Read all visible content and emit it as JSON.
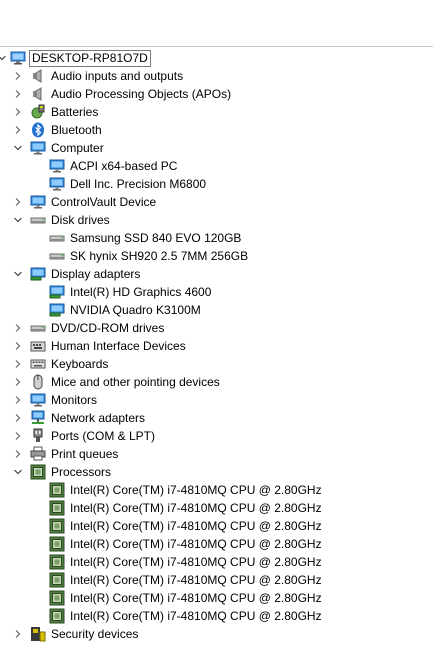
{
  "tree": {
    "root": {
      "label": "DESKTOP-RP81O7D",
      "icon": "computer-icon"
    },
    "categories": [
      {
        "label": "Audio inputs and outputs",
        "icon": "speaker-icon",
        "expanded": false,
        "children": []
      },
      {
        "label": "Audio Processing Objects (APOs)",
        "icon": "speaker-icon",
        "expanded": false,
        "children": []
      },
      {
        "label": "Batteries",
        "icon": "battery-icon",
        "expanded": false,
        "children": []
      },
      {
        "label": "Bluetooth",
        "icon": "bluetooth-icon",
        "expanded": false,
        "children": []
      },
      {
        "label": "Computer",
        "icon": "monitor-icon",
        "expanded": true,
        "children": [
          {
            "label": "ACPI x64-based PC",
            "icon": "monitor-icon"
          },
          {
            "label": "Dell Inc. Precision M6800",
            "icon": "monitor-icon"
          }
        ]
      },
      {
        "label": "ControlVault Device",
        "icon": "monitor-icon",
        "expanded": false,
        "children": []
      },
      {
        "label": "Disk drives",
        "icon": "drive-icon",
        "expanded": true,
        "children": [
          {
            "label": "Samsung SSD 840 EVO 120GB",
            "icon": "drive-icon"
          },
          {
            "label": "SK hynix SH920 2.5 7MM 256GB",
            "icon": "drive-icon"
          }
        ]
      },
      {
        "label": "Display adapters",
        "icon": "display-adapter-icon",
        "expanded": true,
        "children": [
          {
            "label": "Intel(R) HD Graphics 4600",
            "icon": "display-adapter-icon"
          },
          {
            "label": "NVIDIA Quadro K3100M",
            "icon": "display-adapter-icon"
          }
        ]
      },
      {
        "label": "DVD/CD-ROM drives",
        "icon": "drive-icon",
        "expanded": false,
        "children": []
      },
      {
        "label": "Human Interface Devices",
        "icon": "hid-icon",
        "expanded": false,
        "children": []
      },
      {
        "label": "Keyboards",
        "icon": "keyboard-icon",
        "expanded": false,
        "children": []
      },
      {
        "label": "Mice and other pointing devices",
        "icon": "mouse-icon",
        "expanded": false,
        "children": []
      },
      {
        "label": "Monitors",
        "icon": "monitor-icon",
        "expanded": false,
        "children": []
      },
      {
        "label": "Network adapters",
        "icon": "network-icon",
        "expanded": false,
        "children": []
      },
      {
        "label": "Ports (COM & LPT)",
        "icon": "port-icon",
        "expanded": false,
        "children": []
      },
      {
        "label": "Print queues",
        "icon": "printer-icon",
        "expanded": false,
        "children": []
      },
      {
        "label": "Processors",
        "icon": "processor-icon",
        "expanded": true,
        "children": [
          {
            "label": "Intel(R) Core(TM) i7-4810MQ CPU @ 2.80GHz",
            "icon": "processor-icon"
          },
          {
            "label": "Intel(R) Core(TM) i7-4810MQ CPU @ 2.80GHz",
            "icon": "processor-icon"
          },
          {
            "label": "Intel(R) Core(TM) i7-4810MQ CPU @ 2.80GHz",
            "icon": "processor-icon"
          },
          {
            "label": "Intel(R) Core(TM) i7-4810MQ CPU @ 2.80GHz",
            "icon": "processor-icon"
          },
          {
            "label": "Intel(R) Core(TM) i7-4810MQ CPU @ 2.80GHz",
            "icon": "processor-icon"
          },
          {
            "label": "Intel(R) Core(TM) i7-4810MQ CPU @ 2.80GHz",
            "icon": "processor-icon"
          },
          {
            "label": "Intel(R) Core(TM) i7-4810MQ CPU @ 2.80GHz",
            "icon": "processor-icon"
          },
          {
            "label": "Intel(R) Core(TM) i7-4810MQ CPU @ 2.80GHz",
            "icon": "processor-icon"
          }
        ]
      },
      {
        "label": "Security devices",
        "icon": "security-icon",
        "expanded": false,
        "children": []
      }
    ]
  }
}
